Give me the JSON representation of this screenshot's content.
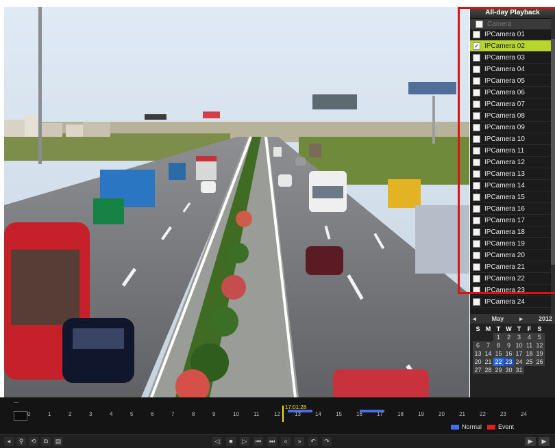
{
  "panel": {
    "title": "All-day Playback",
    "camera_header": "Camera",
    "cameras": [
      {
        "label": "IPCamera 01",
        "checked": false
      },
      {
        "label": "IPCamera 02",
        "checked": true
      },
      {
        "label": "IPCamera 03",
        "checked": false
      },
      {
        "label": "IPCamera 04",
        "checked": false
      },
      {
        "label": "IPCamera 05",
        "checked": false
      },
      {
        "label": "IPCamera 06",
        "checked": false
      },
      {
        "label": "IPCamera 07",
        "checked": false
      },
      {
        "label": "IPCamera 08",
        "checked": false
      },
      {
        "label": "IPCamera 09",
        "checked": false
      },
      {
        "label": "IPCamera 10",
        "checked": false
      },
      {
        "label": "IPCamera 11",
        "checked": false
      },
      {
        "label": "IPCamera 12",
        "checked": false
      },
      {
        "label": "IPCamera 13",
        "checked": false
      },
      {
        "label": "IPCamera 14",
        "checked": false
      },
      {
        "label": "IPCamera 15",
        "checked": false
      },
      {
        "label": "IPCamera 16",
        "checked": false
      },
      {
        "label": "IPCamera 17",
        "checked": false
      },
      {
        "label": "IPCamera 18",
        "checked": false
      },
      {
        "label": "IPCamera 19",
        "checked": false
      },
      {
        "label": "IPCamera 20",
        "checked": false
      },
      {
        "label": "IPCamera 21",
        "checked": false
      },
      {
        "label": "IPCamera 22",
        "checked": false
      },
      {
        "label": "IPCamera 23",
        "checked": false
      },
      {
        "label": "IPCamera 24",
        "checked": false
      }
    ],
    "checkmark": "✓"
  },
  "calendar": {
    "month": "May",
    "year": "2012",
    "prev": "◂",
    "next": "▸",
    "weekdays": [
      "S",
      "M",
      "T",
      "W",
      "T",
      "F",
      "S"
    ],
    "weeks": [
      [
        "",
        "",
        "1",
        "2",
        "3",
        "4",
        "5"
      ],
      [
        "6",
        "7",
        "8",
        "9",
        "10",
        "11",
        "12"
      ],
      [
        "13",
        "14",
        "15",
        "16",
        "17",
        "18",
        "19"
      ],
      [
        "20",
        "21",
        "22",
        "23",
        "24",
        "25",
        "26"
      ],
      [
        "27",
        "28",
        "29",
        "30",
        "31",
        "",
        ""
      ]
    ],
    "selected_day": "22",
    "today": "23"
  },
  "timeline": {
    "ticks": [
      "0",
      "1",
      "2",
      "3",
      "4",
      "5",
      "6",
      "7",
      "8",
      "9",
      "10",
      "11",
      "12",
      "13",
      "14",
      "15",
      "16",
      "17",
      "18",
      "19",
      "20",
      "21",
      "22",
      "23",
      "24"
    ],
    "current_time": "17:01:28",
    "legend_normal": "Normal",
    "legend_event": "Event",
    "colors": {
      "normal": "#4a6cf0",
      "event": "#e02020",
      "cursor": "#f5e11a"
    }
  },
  "toolbar": {
    "left_icons": [
      "◂",
      "⚲",
      "⟲",
      "⧉",
      "▤"
    ],
    "center_icons": [
      "◁",
      "■",
      "▷",
      "⏮",
      "⏭",
      "«",
      "»",
      "↶",
      "↷"
    ],
    "right_icons": [
      "▶",
      "▶"
    ]
  },
  "colors": {
    "selected_row": "#b7d52a",
    "highlight_border": "#e01010",
    "calendar_highlight": "#2b6be0"
  }
}
